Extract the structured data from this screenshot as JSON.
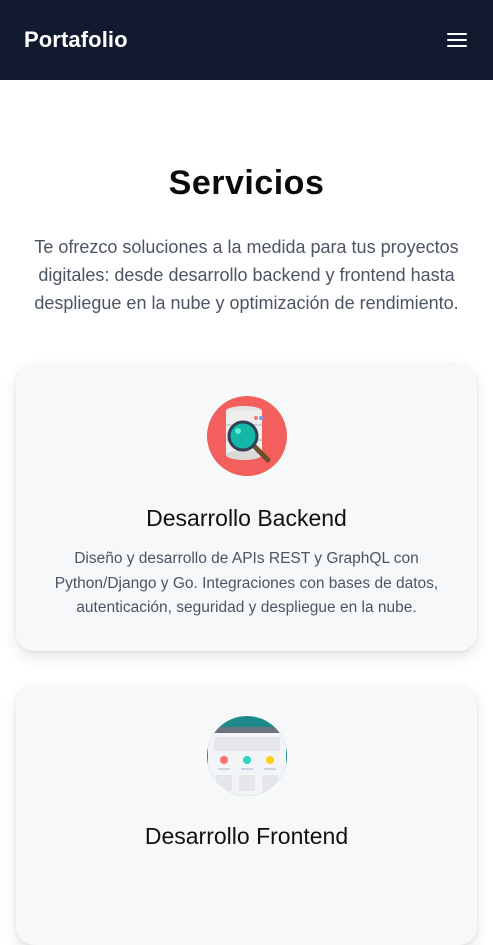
{
  "navbar": {
    "brand": "Portafolio",
    "menu_icon": "hamburger-menu-icon"
  },
  "services": {
    "title": "Servicios",
    "intro": "Te ofrezco soluciones a la medida para tus proyectos digitales: desde desarrollo backend y frontend hasta despliegue en la nube y optimización de rendimiento.",
    "cards": [
      {
        "icon": "database-search-icon",
        "title": "Desarrollo Backend",
        "description": "Diseño y desarrollo de APIs REST y GraphQL con Python/Django y Go. Integraciones con bases de datos, autenticación, seguridad y despliegue en la nube."
      },
      {
        "icon": "web-browser-icon",
        "title": "Desarrollo Frontend"
      }
    ]
  },
  "colors": {
    "navbar_bg": "#111a2e",
    "card_bg": "#f7f8fa",
    "backend_icon_circle": "#f25f5c",
    "frontend_icon_circle": "#1f8a8a",
    "magnifier_lens": "#14b8a6"
  }
}
